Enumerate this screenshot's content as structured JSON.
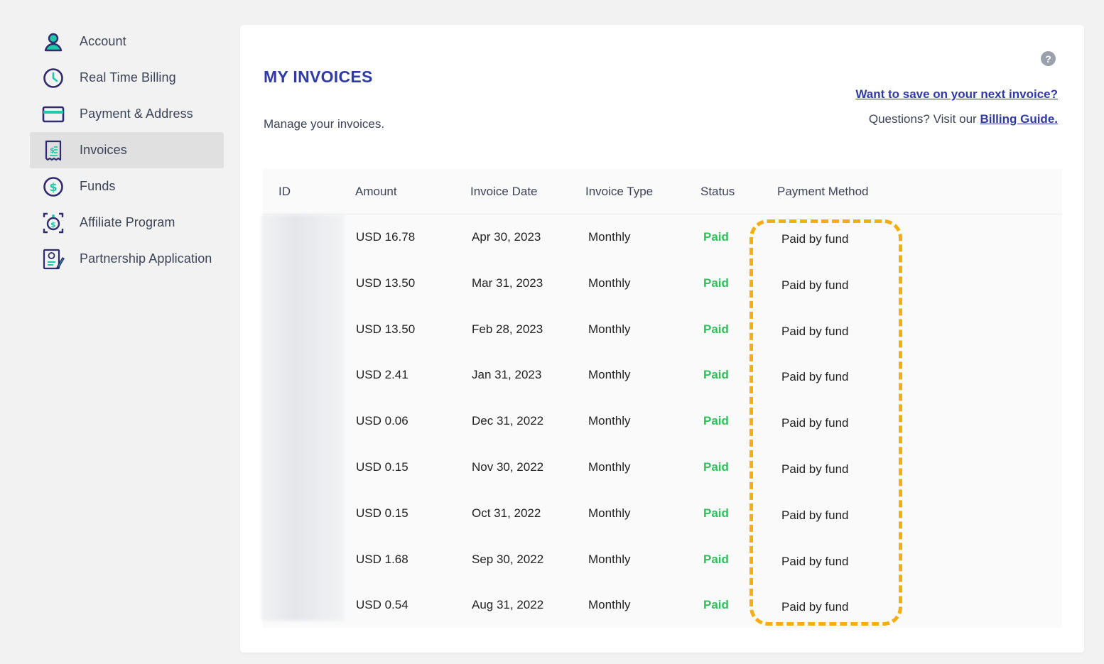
{
  "sidebar": {
    "items": [
      {
        "label": "Account",
        "icon": "user-icon",
        "active": false
      },
      {
        "label": "Real Time Billing",
        "icon": "clock-icon",
        "active": false
      },
      {
        "label": "Payment & Address",
        "icon": "credit-card-icon",
        "active": false
      },
      {
        "label": "Invoices",
        "icon": "invoice-icon",
        "active": true
      },
      {
        "label": "Funds",
        "icon": "dollar-coin-icon",
        "active": false
      },
      {
        "label": "Affiliate Program",
        "icon": "affiliate-icon",
        "active": false
      },
      {
        "label": "Partnership Application",
        "icon": "application-form-icon",
        "active": false
      }
    ]
  },
  "header": {
    "title": "MY INVOICES",
    "subtitle": "Manage your invoices.",
    "save_link": "Want to save on your next invoice?",
    "guide_prefix": "Questions? Visit our",
    "guide_link": "Billing Guide.",
    "help_label": "?"
  },
  "table": {
    "columns": [
      "ID",
      "Amount",
      "Invoice Date",
      "Invoice Type",
      "Status",
      "Payment Method"
    ],
    "rows": [
      {
        "amount": "USD 16.78",
        "date": "Apr 30, 2023",
        "type": "Monthly",
        "status": "Paid",
        "method": "Paid by fund"
      },
      {
        "amount": "USD 13.50",
        "date": "Mar 31, 2023",
        "type": "Monthly",
        "status": "Paid",
        "method": "Paid by fund"
      },
      {
        "amount": "USD 13.50",
        "date": "Feb 28, 2023",
        "type": "Monthly",
        "status": "Paid",
        "method": "Paid by fund"
      },
      {
        "amount": "USD 2.41",
        "date": "Jan 31, 2023",
        "type": "Monthly",
        "status": "Paid",
        "method": "Paid by fund"
      },
      {
        "amount": "USD 0.06",
        "date": "Dec 31, 2022",
        "type": "Monthly",
        "status": "Paid",
        "method": "Paid by fund"
      },
      {
        "amount": "USD 0.15",
        "date": "Nov 30, 2022",
        "type": "Monthly",
        "status": "Paid",
        "method": "Paid by fund"
      },
      {
        "amount": "USD 0.15",
        "date": "Oct 31, 2022",
        "type": "Monthly",
        "status": "Paid",
        "method": "Paid by fund"
      },
      {
        "amount": "USD 1.68",
        "date": "Sep 30, 2022",
        "type": "Monthly",
        "status": "Paid",
        "method": "Paid by fund"
      },
      {
        "amount": "USD 0.54",
        "date": "Aug 31, 2022",
        "type": "Monthly",
        "status": "Paid",
        "method": "Paid by fund"
      }
    ]
  },
  "colors": {
    "accent": "#2f3aa6",
    "status_paid": "#2fbf5b",
    "highlight": "#f5ad0f",
    "icon_teal": "#1fc8a9",
    "icon_dark": "#2e2c6e"
  }
}
